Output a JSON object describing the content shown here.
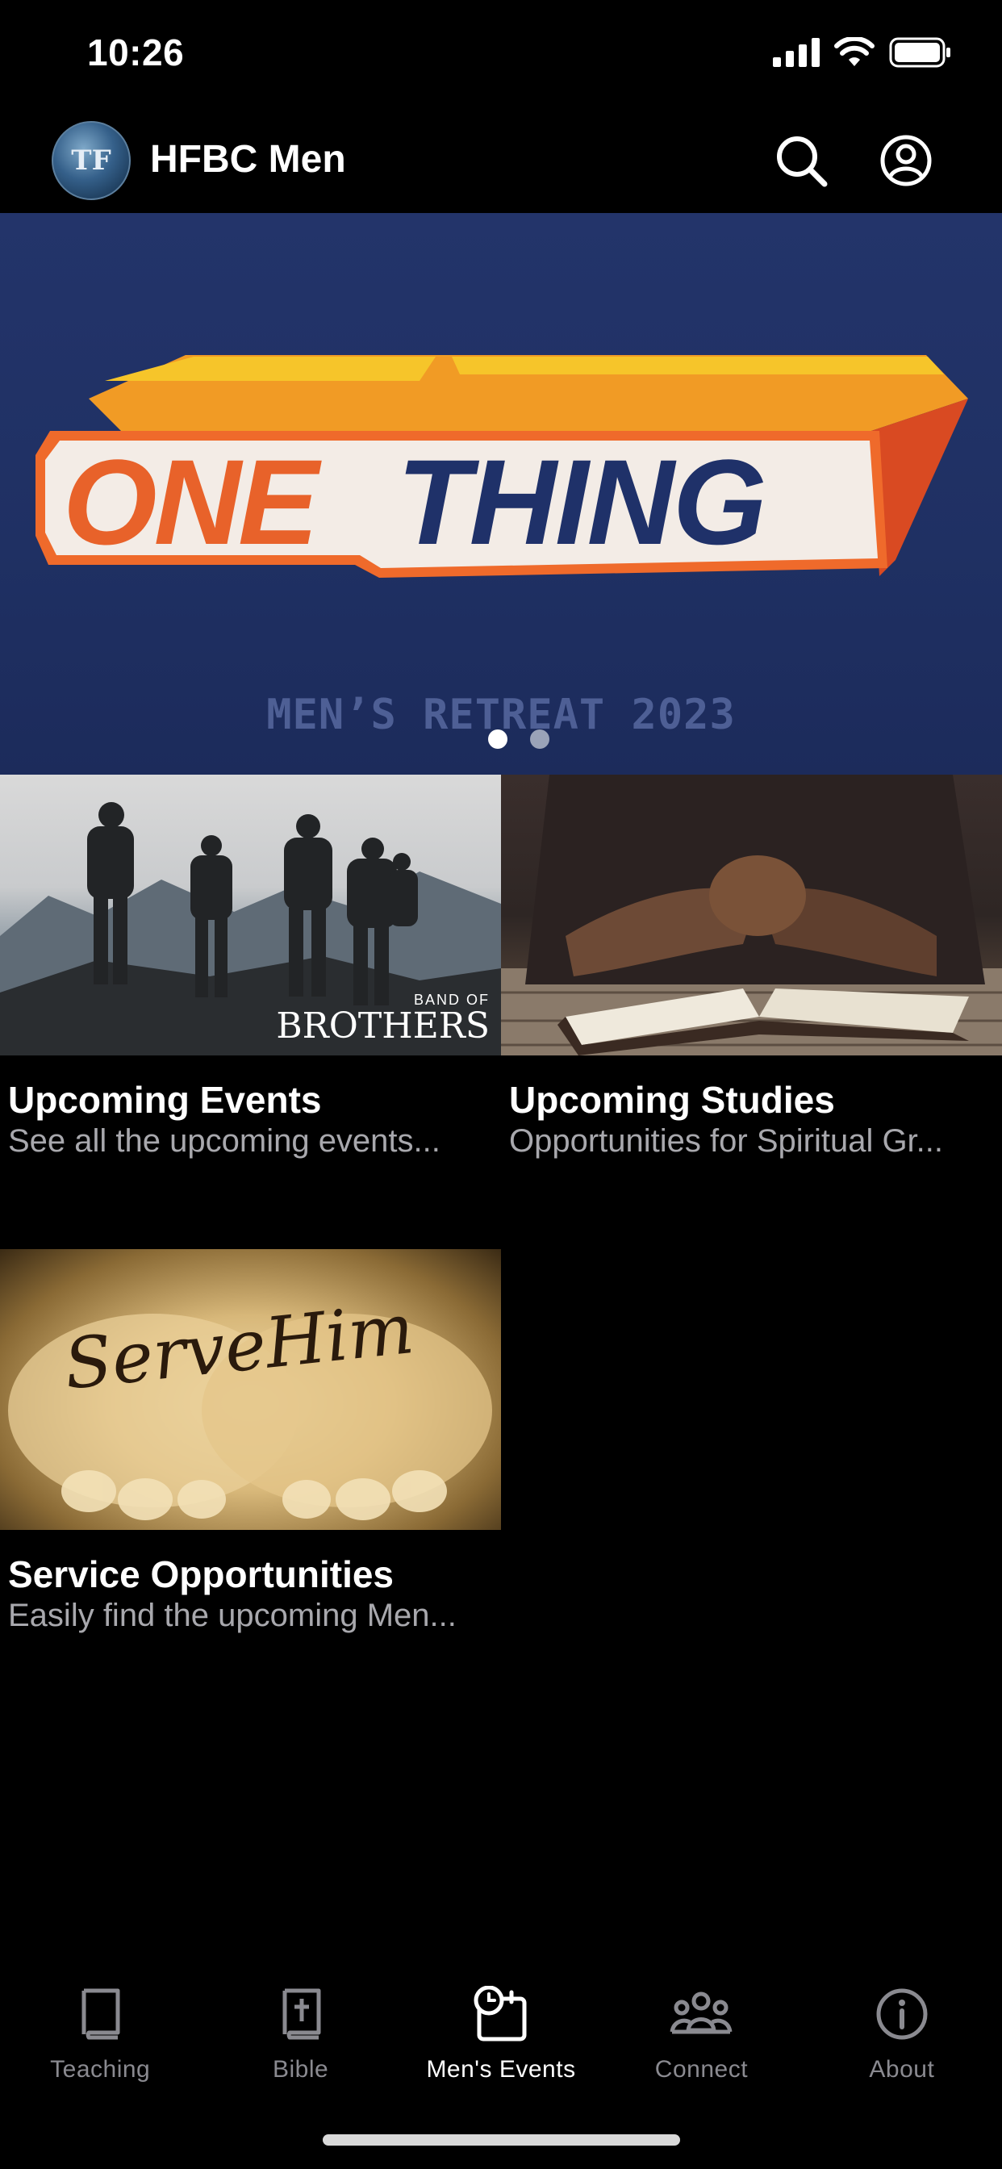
{
  "status_bar": {
    "time": "10:26"
  },
  "header": {
    "title": "HFBC Men",
    "logo_text": "TF"
  },
  "hero": {
    "headline_left": "ONE",
    "headline_right": "THING",
    "subtitle": "MEN’S RETREAT 2023",
    "page_count": 2,
    "active_page": 1
  },
  "cards": [
    {
      "title": "Upcoming Events",
      "description": "See all the upcoming events...",
      "image_text_small": "BAND OF",
      "image_text_large": "BROTHERS"
    },
    {
      "title": "Upcoming Studies",
      "description": "Opportunities for Spiritual Gr..."
    },
    {
      "title": "Service Opportunities",
      "description": "Easily find the upcoming Men...",
      "image_text": "ServeHim"
    }
  ],
  "tabs": [
    {
      "label": "Teaching",
      "icon": "book-icon",
      "active": false
    },
    {
      "label": "Bible",
      "icon": "bible-icon",
      "active": false
    },
    {
      "label": "Men's Events",
      "icon": "calendar-clock-icon",
      "active": true
    },
    {
      "label": "Connect",
      "icon": "group-icon",
      "active": false
    },
    {
      "label": "About",
      "icon": "info-icon",
      "active": false
    }
  ],
  "colors": {
    "background": "#000000",
    "hero_background": "#1f3063",
    "hero_orange": "#e8622a",
    "hero_navy": "#1f3169",
    "tab_inactive": "#8a8a90",
    "tab_active": "#ffffff"
  }
}
